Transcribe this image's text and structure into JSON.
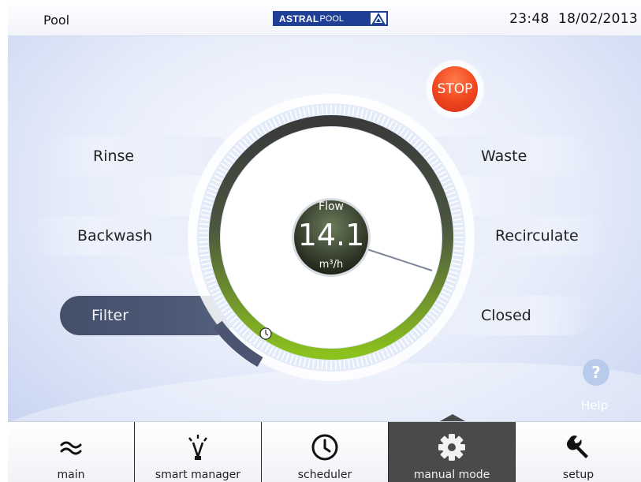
{
  "header": {
    "title": "Pool",
    "brand_bold": "ASTRAL",
    "brand_light": "POOL",
    "time": "23:48",
    "date": "18/02/2013"
  },
  "controls": {
    "stop_label": "STOP",
    "left_buttons": [
      "Rinse",
      "Backwash",
      "Filter"
    ],
    "right_buttons": [
      "Waste",
      "Recirculate",
      "Closed"
    ],
    "active_position": "Filter"
  },
  "gauge": {
    "label": "Flow",
    "value": "14.1",
    "unit": "m³/h"
  },
  "help_label": "Help",
  "nav": {
    "items": [
      {
        "label": "main",
        "icon": "waves-icon"
      },
      {
        "label": "smart manager",
        "icon": "lightbulb-icon"
      },
      {
        "label": "scheduler",
        "icon": "clock-icon"
      },
      {
        "label": "manual mode",
        "icon": "gear-icon"
      },
      {
        "label": "setup",
        "icon": "wrench-icon"
      }
    ],
    "active_index": 3
  },
  "colors": {
    "accent_green": "#8cc21d",
    "stop_red": "#f0461f",
    "active_tab": "#4a4a4a"
  }
}
